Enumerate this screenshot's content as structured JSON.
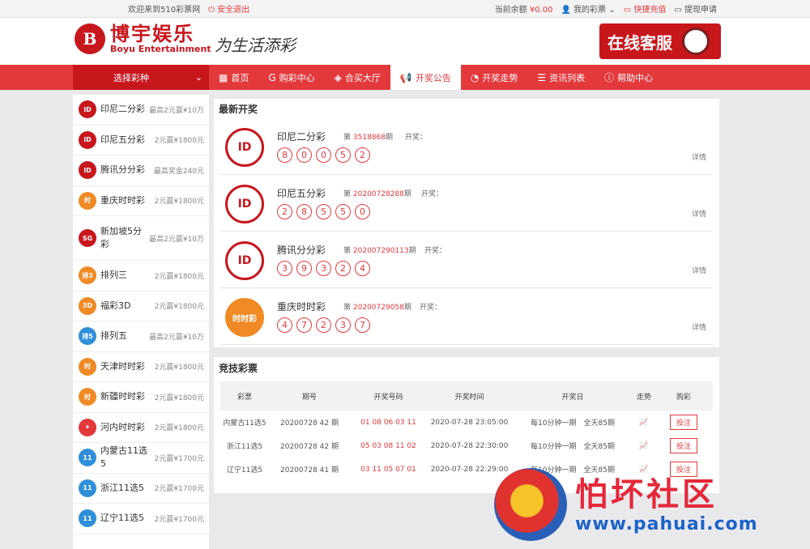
{
  "topbar": {
    "welcome": "欢迎来到510彩票网",
    "logout": "安全退出",
    "balance_label": "当前余额",
    "balance": "¥0.00",
    "my_lottery": "我的彩票",
    "recharge": "快捷充值",
    "withdraw": "提现申请"
  },
  "header": {
    "logo_cn": "博宇娱乐",
    "logo_en": "Boyu Entertainment",
    "slogan": "为生活添彩",
    "customer_service": "在线客服"
  },
  "nav": {
    "select_label": "选择彩种",
    "items": [
      {
        "label": "首页",
        "icon": "home-icon"
      },
      {
        "label": "购彩中心",
        "icon": "g-icon"
      },
      {
        "label": "合买大厅",
        "icon": "handshake-icon"
      },
      {
        "label": "开奖公告",
        "icon": "megaphone-icon"
      },
      {
        "label": "开奖走势",
        "icon": "pie-icon"
      },
      {
        "label": "资讯列表",
        "icon": "list-icon"
      },
      {
        "label": "帮助中心",
        "icon": "help-icon"
      }
    ]
  },
  "sidebar": {
    "items": [
      {
        "name": "印尼二分彩",
        "desc": "最高2元赢¥10万",
        "color": "#c8161d"
      },
      {
        "name": "印尼五分彩",
        "desc": "2元赢¥1800元",
        "color": "#c8161d"
      },
      {
        "name": "腾讯分分彩",
        "desc": "最高奖金240元",
        "color": "#c8161d"
      },
      {
        "name": "重庆时时彩",
        "desc": "2元赢¥1800元",
        "color": "#f08a24"
      },
      {
        "name": "新加坡5分彩",
        "desc": "最高2元赢¥10万",
        "color": "#c8161d"
      },
      {
        "name": "排列三",
        "desc": "2元赢¥1800元",
        "color": "#f08a24"
      },
      {
        "name": "福彩3D",
        "desc": "2元赢¥1800元",
        "color": "#f08a24"
      },
      {
        "name": "排列五",
        "desc": "最高2元赢¥10万",
        "color": "#2f8fd8"
      },
      {
        "name": "天津时时彩",
        "desc": "2元赢¥1800元",
        "color": "#f08a24"
      },
      {
        "name": "新疆时时彩",
        "desc": "2元赢¥1800元",
        "color": "#f08a24"
      },
      {
        "name": "河内时时彩",
        "desc": "2元赢¥1800元",
        "color": "#e4393c"
      },
      {
        "name": "内蒙古11选5",
        "desc": "2元赢¥1700元",
        "color": "#2f8fd8"
      },
      {
        "name": "浙江11选5",
        "desc": "2元赢¥1700元",
        "color": "#2f8fd8"
      },
      {
        "name": "辽宁11选5",
        "desc": "2元赢¥1700元",
        "color": "#2f8fd8"
      }
    ]
  },
  "latest": {
    "title": "最新开奖",
    "period_prefix": "第",
    "period_suffix": "期",
    "open_label": "开奖：",
    "detail": "详情",
    "draws": [
      {
        "name": "印尼二分彩",
        "period": "3518868",
        "balls": [
          "8",
          "0",
          "0",
          "5",
          "2"
        ],
        "logo": "ID"
      },
      {
        "name": "印尼五分彩",
        "period": "20200728288",
        "balls": [
          "2",
          "8",
          "5",
          "5",
          "0"
        ],
        "logo": "ID"
      },
      {
        "name": "腾讯分分彩",
        "period": "202007290113",
        "balls": [
          "3",
          "9",
          "3",
          "2",
          "4"
        ],
        "logo": "ID"
      },
      {
        "name": "重庆时时彩",
        "period": "20200729058",
        "balls": [
          "4",
          "7",
          "2",
          "3",
          "7"
        ],
        "logo": "时时彩"
      }
    ]
  },
  "competitive": {
    "title": "竞技彩票",
    "headers": [
      "彩票",
      "期号",
      "开奖号码",
      "开奖时间",
      "开奖日",
      "走势",
      "购彩"
    ],
    "rows": [
      {
        "lottery": "内蒙古11选5",
        "period": "20200728 42 期",
        "numbers": "01 08 06 03 11",
        "time": "2020-07-28 23:05:00",
        "freq": "每10分钟一期",
        "total": "全天85期",
        "trend": "📈",
        "bet": "投注"
      },
      {
        "lottery": "浙江11选5",
        "period": "20200728 42 期",
        "numbers": "05 03 08 11 02",
        "time": "2020-07-28 22:30:00",
        "freq": "每10分钟一期",
        "total": "全天85期",
        "trend": "📈",
        "bet": "投注"
      },
      {
        "lottery": "辽宁11选5",
        "period": "20200728 41 期",
        "numbers": "03 11 05 07 01",
        "time": "2020-07-28 22:29:00",
        "freq": "每10分钟一期",
        "total": "全天85期",
        "trend": "📈",
        "bet": "投注"
      }
    ]
  },
  "watermark": {
    "cn": "怕坏社区",
    "url": "www.pahuai.com"
  }
}
